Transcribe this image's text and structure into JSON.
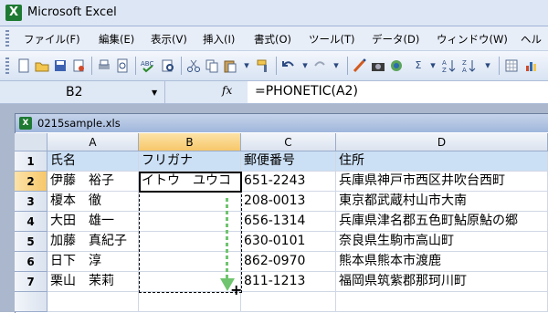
{
  "app": {
    "title": "Microsoft Excel",
    "icon": "X"
  },
  "menu": {
    "items": [
      {
        "label": "ファイル(F)"
      },
      {
        "label": "編集(E)"
      },
      {
        "label": "表示(V)"
      },
      {
        "label": "挿入(I)"
      },
      {
        "label": "書式(O)"
      },
      {
        "label": "ツール(T)"
      },
      {
        "label": "データ(D)"
      },
      {
        "label": "ウィンドウ(W)"
      },
      {
        "label": "ヘル"
      }
    ]
  },
  "toolbar": {
    "icons": [
      "new-icon",
      "open-icon",
      "save-icon",
      "permission-icon",
      "print-icon",
      "print-preview-icon",
      "spelling-icon",
      "research-icon",
      "cut-icon",
      "copy-icon",
      "paste-icon",
      "format-painter-icon",
      "undo-icon",
      "redo-icon",
      "drawing-icon",
      "camera-icon",
      "autosum-icon",
      "sigma-icon",
      "sort-ascending-icon",
      "sort-descending-icon",
      "chart-icon"
    ],
    "sigma": "Σ"
  },
  "formula_bar": {
    "name_box": "B2",
    "fx": "fx",
    "formula": "=PHONETIC(A2)"
  },
  "workbook": {
    "title": "0215sample.xls",
    "icon": "X"
  },
  "sheet": {
    "columns": [
      "A",
      "B",
      "C",
      "D"
    ],
    "rows": [
      {
        "num": "1",
        "a": "氏名",
        "b": "フリガナ",
        "c": "郵便番号",
        "d": "住所"
      },
      {
        "num": "2",
        "a": "伊藤　裕子",
        "b": "イトウ　ユウコ",
        "c": "651-2243",
        "d": "兵庫県神戸市西区井吹台西町"
      },
      {
        "num": "3",
        "a": "榎本　徹",
        "b": "",
        "c": "208-0013",
        "d": "東京都武蔵村山市大南"
      },
      {
        "num": "4",
        "a": "大田　雄一",
        "b": "",
        "c": "656-1314",
        "d": "兵庫県津名郡五色町鮎原鮎の郷"
      },
      {
        "num": "5",
        "a": "加藤　真紀子",
        "b": "",
        "c": "630-0101",
        "d": "奈良県生駒市高山町"
      },
      {
        "num": "6",
        "a": "日下　淳",
        "b": "",
        "c": "862-0970",
        "d": "熊本県熊本市渡鹿"
      },
      {
        "num": "7",
        "a": "栗山　茉莉",
        "b": "",
        "c": "811-1213",
        "d": "福岡県筑紫郡那珂川町"
      }
    ]
  },
  "colors": {
    "header_fill": "#cce0f5",
    "selected_header": "#f7c76a",
    "fill_handle_arrow": "#6fc46f"
  }
}
